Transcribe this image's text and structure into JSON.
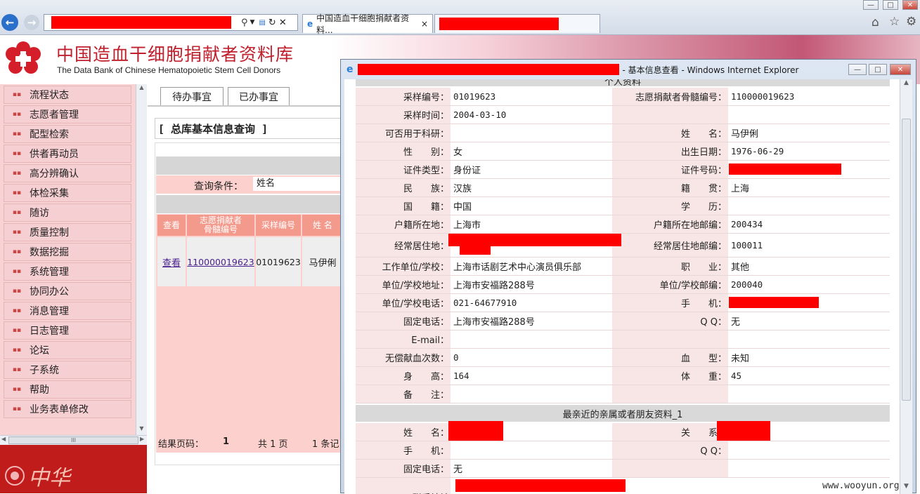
{
  "browser": {
    "tab_title": "中国造血干细胞捐献者资料...",
    "tab_close": "×",
    "win_minimize": "—",
    "win_maximize": "□",
    "win_close": "✕"
  },
  "site": {
    "title_cn": "中国造血干细胞捐献者资料库",
    "title_en": "The Data Bank of Chinese Hematopoietic Stem Cell Donors",
    "logo_text": "中华"
  },
  "sidebar": {
    "items": [
      "流程状态",
      "志愿者管理",
      "配型检索",
      "供者再动员",
      "高分辨确认",
      "体检采集",
      "随访",
      "质量控制",
      "数据挖掘",
      "系统管理",
      "协同办公",
      "消息管理",
      "日志管理",
      "论坛",
      "子系统",
      "帮助",
      "业务表单修改"
    ],
    "scroll_thumb": "III"
  },
  "content": {
    "tabs": [
      "待办事宜",
      "已办事宜"
    ],
    "query_title": "[ 总库基本信息查询 ]",
    "query_label": "查询条件：",
    "query_value": "姓名",
    "table_headers": [
      "查看",
      "志愿捐献者\n骨髓编号",
      "采样编号",
      "姓 名"
    ],
    "row": {
      "view": "查看",
      "donor_no": "110000019623",
      "sample_no": "01019623",
      "name": "马伊俐"
    },
    "footer": {
      "page_label": "结果页码：",
      "page": "1",
      "total": "共 1 页",
      "count": "1 条记"
    }
  },
  "popup": {
    "title": "- 基本信息查看 - Windows Internet Explorer",
    "section_personal": "个人资料",
    "fields": [
      {
        "l1": "采样编号：",
        "v1": "01019623",
        "l2": "志愿捐献者骨髓编号：",
        "v2": "110000019623"
      },
      {
        "l1": "采样时间：",
        "v1": "2004-03-10",
        "l2": "",
        "v2": ""
      },
      {
        "l1": "可否用于科研：",
        "v1": "",
        "l2": "姓　　名：",
        "v2": "马伊俐"
      },
      {
        "l1": "性　　别：",
        "v1": "女",
        "l2": "出生日期：",
        "v2": "1976-06-29"
      },
      {
        "l1": "证件类型：",
        "v1": "身份证",
        "l2": "证件号码：",
        "v2": ""
      },
      {
        "l1": "民　　族：",
        "v1": "汉族",
        "l2": "籍　　贯：",
        "v2": "上海"
      },
      {
        "l1": "国　　籍：",
        "v1": "中国",
        "l2": "学　　历：",
        "v2": ""
      },
      {
        "l1": "户籍所在地：",
        "v1": "上海市",
        "l2": "户籍所在地邮编：",
        "v2": "200434"
      },
      {
        "l1": "经常居住地：",
        "v1": "",
        "l2": "经常居住地邮编：",
        "v2": "100011"
      },
      {
        "l1": "工作单位/学校：",
        "v1": "上海市话剧艺术中心演员俱乐部",
        "l2": "职　　业：",
        "v2": "其他"
      },
      {
        "l1": "单位/学校地址：",
        "v1": "上海市安福路288号",
        "l2": "单位/学校邮编：",
        "v2": "200040"
      },
      {
        "l1": "单位/学校电话：",
        "v1": "021-64677910",
        "l2": "手　　机：",
        "v2": ""
      },
      {
        "l1": "固定电话：",
        "v1": "上海市安福路288号",
        "l2": "Q Q：",
        "v2": "无"
      },
      {
        "l1": "E-mail：",
        "v1": "",
        "l2": "",
        "v2": ""
      },
      {
        "l1": "无偿献血次数：",
        "v1": "0",
        "l2": "血　　型：",
        "v2": "未知"
      },
      {
        "l1": "身　　高：",
        "v1": "164",
        "l2": "体　　重：",
        "v2": "45"
      },
      {
        "l1": "备　　注：",
        "v1": "",
        "l2": "",
        "v2": ""
      }
    ],
    "section_contact": "最亲近的亲属或者朋友资料_1",
    "contact_fields": [
      {
        "l1": "姓　　名：",
        "v1": "",
        "l2": "关　　系：",
        "v2": ""
      },
      {
        "l1": "手　　机：",
        "v1": "",
        "l2": "Q Q：",
        "v2": ""
      },
      {
        "l1": "固定电话：",
        "v1": "无",
        "l2": "",
        "v2": ""
      }
    ],
    "partial_row_label": "联系地址"
  },
  "watermark": "www.wooyun.org"
}
